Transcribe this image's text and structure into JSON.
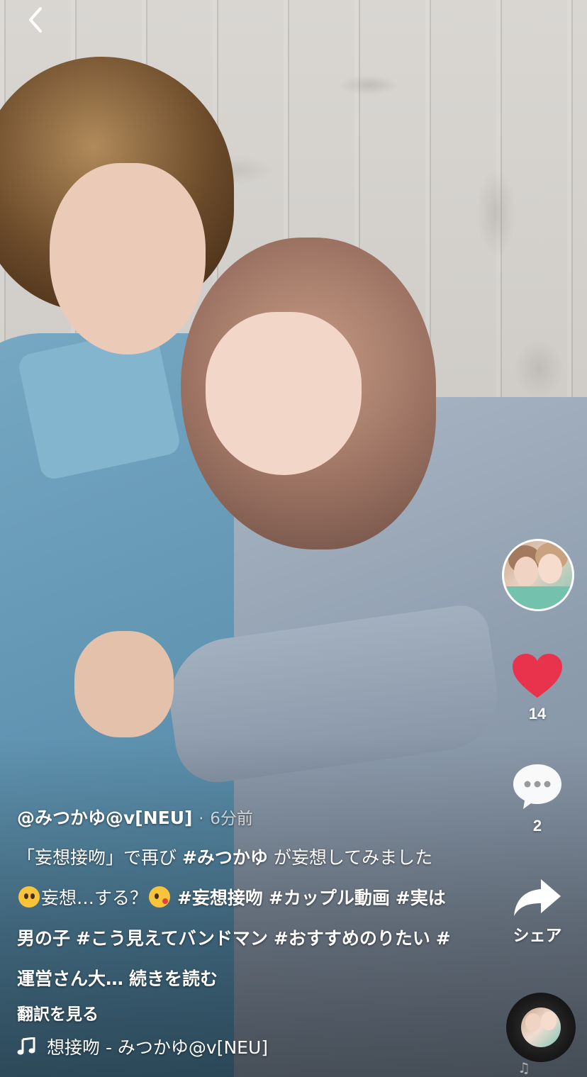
{
  "nav": {
    "back_icon": "chevron-left-icon"
  },
  "author": {
    "handle": "@みつかゆ@v[NEU]",
    "separator": "·",
    "posted": "6分前"
  },
  "description": {
    "text_1": "「妄想接吻」で再び ",
    "tag_1": "#みつかゆ",
    "text_2": " が妄想してみました",
    "emoji_1": "pleading-face-emoji",
    "text_3": "妄想…する？",
    "emoji_2": "kissing-face-emoji",
    "text_4": " ",
    "tags": [
      "#妄想接吻",
      "#カップル動画",
      "#実は男の子",
      "#こう見えてバンドマン",
      "#おすすめのりたい",
      "#運営さん大…"
    ],
    "more": "続きを読む"
  },
  "translate_label": "翻訳を見る",
  "music": {
    "icon": "music-note-icon",
    "title": "想接吻 - みつかゆ@v[NEU]"
  },
  "actions": {
    "like_count": "14",
    "comment_count": "2",
    "share_label": "シェア",
    "like_color": "#e9334c"
  }
}
